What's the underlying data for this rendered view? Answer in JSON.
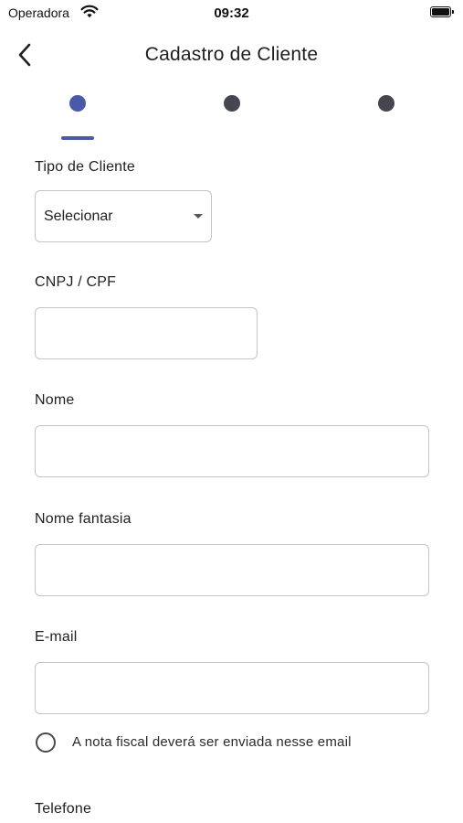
{
  "status_bar": {
    "carrier": "Operadora",
    "time": "09:32",
    "wifi_icon": "wifi-icon",
    "battery_icon": "battery-icon"
  },
  "header": {
    "title": "Cadastro de Cliente",
    "back_icon": "chevron-left-icon"
  },
  "stepper": {
    "active_step": 1,
    "total_steps": 3,
    "active_color": "#4a5aa8",
    "inactive_color": "#44474f"
  },
  "form": {
    "client_type": {
      "label": "Tipo de Cliente",
      "value": "Selecionar"
    },
    "document": {
      "label": "CNPJ / CPF",
      "value": ""
    },
    "name": {
      "label": "Nome",
      "value": ""
    },
    "trade_name": {
      "label": "Nome fantasia",
      "value": ""
    },
    "email": {
      "label": "E-mail",
      "value": ""
    },
    "invoice_email_option": {
      "label": "A nota fiscal deverá ser enviada nesse email",
      "checked": false
    },
    "phone": {
      "label": "Telefone"
    }
  }
}
